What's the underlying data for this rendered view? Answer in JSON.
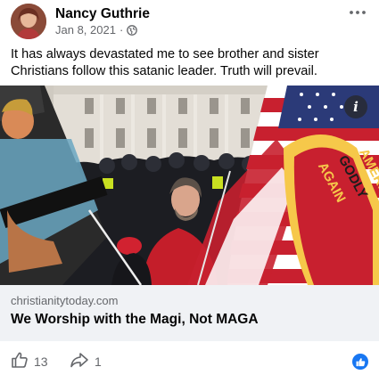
{
  "post": {
    "author": "Nancy Guthrie",
    "date": "Jan 8, 2021",
    "separator": "·",
    "privacy_icon": "globe-icon",
    "text": "It has always devastated me to see brother and sister Christians follow this satanic leader. Truth will prevail."
  },
  "link_card": {
    "domain": "christianitytoday.com",
    "title": "We Worship with the Magi, Not MAGA",
    "info_label": "i",
    "flag_text": [
      "MA",
      "AMERI",
      "GODLY",
      "AGAIN"
    ]
  },
  "footer": {
    "like_count": "13",
    "share_count": "1"
  },
  "colors": {
    "accent": "#1877f2",
    "secondary_text": "#65676b",
    "card_bg": "#f0f2f5"
  }
}
